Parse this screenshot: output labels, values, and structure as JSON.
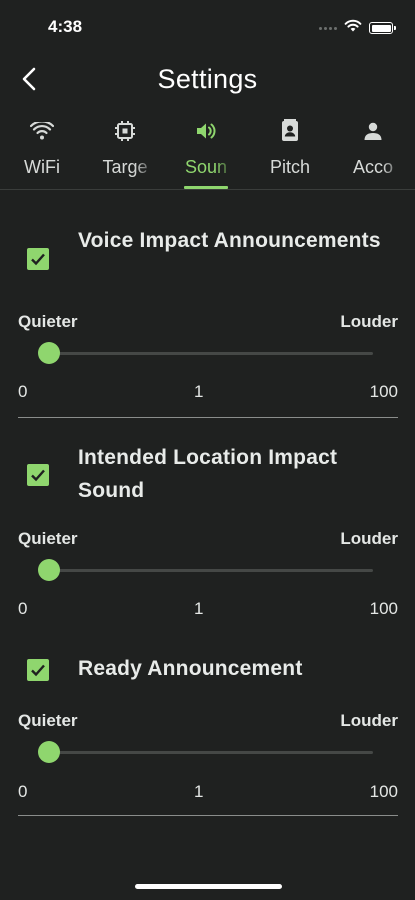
{
  "status_bar": {
    "time": "4:38"
  },
  "header": {
    "title": "Settings",
    "back_icon": "chevron-left-icon"
  },
  "tabs": [
    {
      "label": "WiFi",
      "icon": "wifi-icon",
      "active": false
    },
    {
      "label": "Targe",
      "icon": "target-icon",
      "active": false
    },
    {
      "label": "Soun",
      "icon": "speaker-icon",
      "active": true
    },
    {
      "label": "Pitch",
      "icon": "contact-card-icon",
      "active": false
    },
    {
      "label": "Acco",
      "icon": "person-icon",
      "active": false
    }
  ],
  "sections": [
    {
      "title": "Voice Impact Announcements",
      "checked": true,
      "slider": {
        "min_label": "Quieter",
        "max_label": "Louder",
        "scale_min": "0",
        "scale_mid": "1",
        "scale_max": "100",
        "value": 1
      }
    },
    {
      "title": "Intended Location Impact Sound",
      "checked": true,
      "slider": {
        "min_label": "Quieter",
        "max_label": "Louder",
        "scale_min": "0",
        "scale_mid": "1",
        "scale_max": "100",
        "value": 1
      }
    },
    {
      "title": "Ready Announcement",
      "checked": true,
      "slider": {
        "min_label": "Quieter",
        "max_label": "Louder",
        "scale_min": "0",
        "scale_mid": "1",
        "scale_max": "100",
        "value": 1
      }
    }
  ],
  "colors": {
    "accent": "#8fd66e",
    "background": "#1f2120",
    "text": "#e9ecea"
  }
}
